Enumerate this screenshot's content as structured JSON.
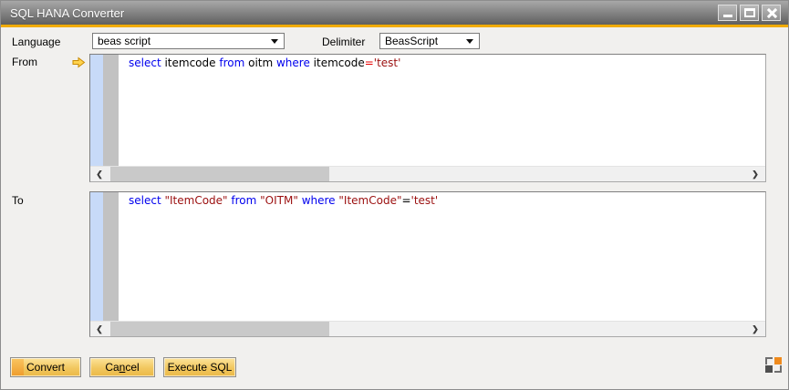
{
  "window": {
    "title": "SQL HANA Converter"
  },
  "form": {
    "language_label": "Language",
    "language_value": "beas script",
    "delimiter_label": "Delimiter",
    "delimiter_value": "BeasScript"
  },
  "syntax_colors": {
    "keyword": "#0000ee",
    "plain": "#000000",
    "string": "#9b0f0f",
    "operator": "#e80000"
  },
  "from_editor": {
    "label": "From",
    "tokens": [
      {
        "t": "select",
        "c": "keyword"
      },
      {
        "t": " itemcode ",
        "c": "plain"
      },
      {
        "t": "from",
        "c": "keyword"
      },
      {
        "t": " oitm ",
        "c": "plain"
      },
      {
        "t": "where",
        "c": "keyword"
      },
      {
        "t": " itemcode",
        "c": "plain"
      },
      {
        "t": "=",
        "c": "operator"
      },
      {
        "t": "'test'",
        "c": "string"
      }
    ]
  },
  "to_editor": {
    "label": "To",
    "tokens": [
      {
        "t": "select",
        "c": "keyword"
      },
      {
        "t": " ",
        "c": "plain"
      },
      {
        "t": "\"ItemCode\"",
        "c": "string"
      },
      {
        "t": " ",
        "c": "plain"
      },
      {
        "t": "from",
        "c": "keyword"
      },
      {
        "t": " ",
        "c": "plain"
      },
      {
        "t": "\"OITM\"",
        "c": "string"
      },
      {
        "t": " ",
        "c": "plain"
      },
      {
        "t": "where",
        "c": "keyword"
      },
      {
        "t": " ",
        "c": "plain"
      },
      {
        "t": "\"ItemCode\"",
        "c": "string"
      },
      {
        "t": "=",
        "c": "plain"
      },
      {
        "t": "'test'",
        "c": "string"
      }
    ]
  },
  "scrollbar": {
    "left_arrow": "❮",
    "right_arrow": "❯"
  },
  "buttons": {
    "convert": "Convert",
    "cancel_pre": "Ca",
    "cancel_mnemonic": "n",
    "cancel_post": "cel",
    "execute": "Execute SQL"
  },
  "accent_color": "#f0ab00"
}
